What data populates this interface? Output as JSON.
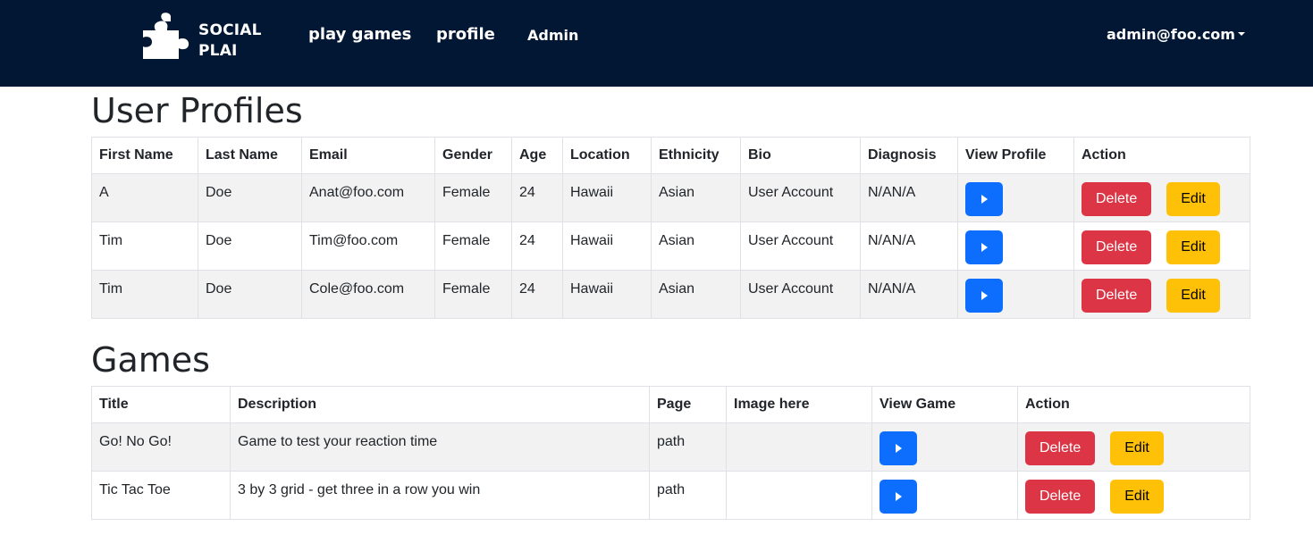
{
  "nav": {
    "brand_line1": "SOCIAL",
    "brand_line2": "PLAI",
    "links": [
      "play games",
      "profile",
      "Admin"
    ],
    "user": "admin@foo.com"
  },
  "profiles": {
    "title": "User Profiles",
    "headers": [
      "First Name",
      "Last Name",
      "Email",
      "Gender",
      "Age",
      "Location",
      "Ethnicity",
      "Bio",
      "Diagnosis",
      "View Profile",
      "Action"
    ],
    "rows": [
      [
        "A",
        "Doe",
        "Anat@foo.com",
        "Female",
        "24",
        "Hawaii",
        "Asian",
        "User Account",
        "N/AN/A"
      ],
      [
        "Tim",
        "Doe",
        "Tim@foo.com",
        "Female",
        "24",
        "Hawaii",
        "Asian",
        "User Account",
        "N/AN/A"
      ],
      [
        "Tim",
        "Doe",
        "Cole@foo.com",
        "Female",
        "24",
        "Hawaii",
        "Asian",
        "User Account",
        "N/AN/A"
      ]
    ]
  },
  "games": {
    "title": "Games",
    "headers": [
      "Title",
      "Description",
      "Page",
      "Image here",
      "View Game",
      "Action"
    ],
    "rows": [
      [
        "Go! No Go!",
        "Game to test your reaction time",
        "path",
        ""
      ],
      [
        "Tic Tac Toe",
        "3 by 3 grid - get three in a row you win",
        "path",
        ""
      ]
    ]
  },
  "buttons": {
    "delete": "Delete",
    "edit": "Edit"
  },
  "colors": {
    "navbar": "#021733",
    "primary": "#0d6efd",
    "danger": "#dc3545",
    "warning": "#ffc107"
  }
}
